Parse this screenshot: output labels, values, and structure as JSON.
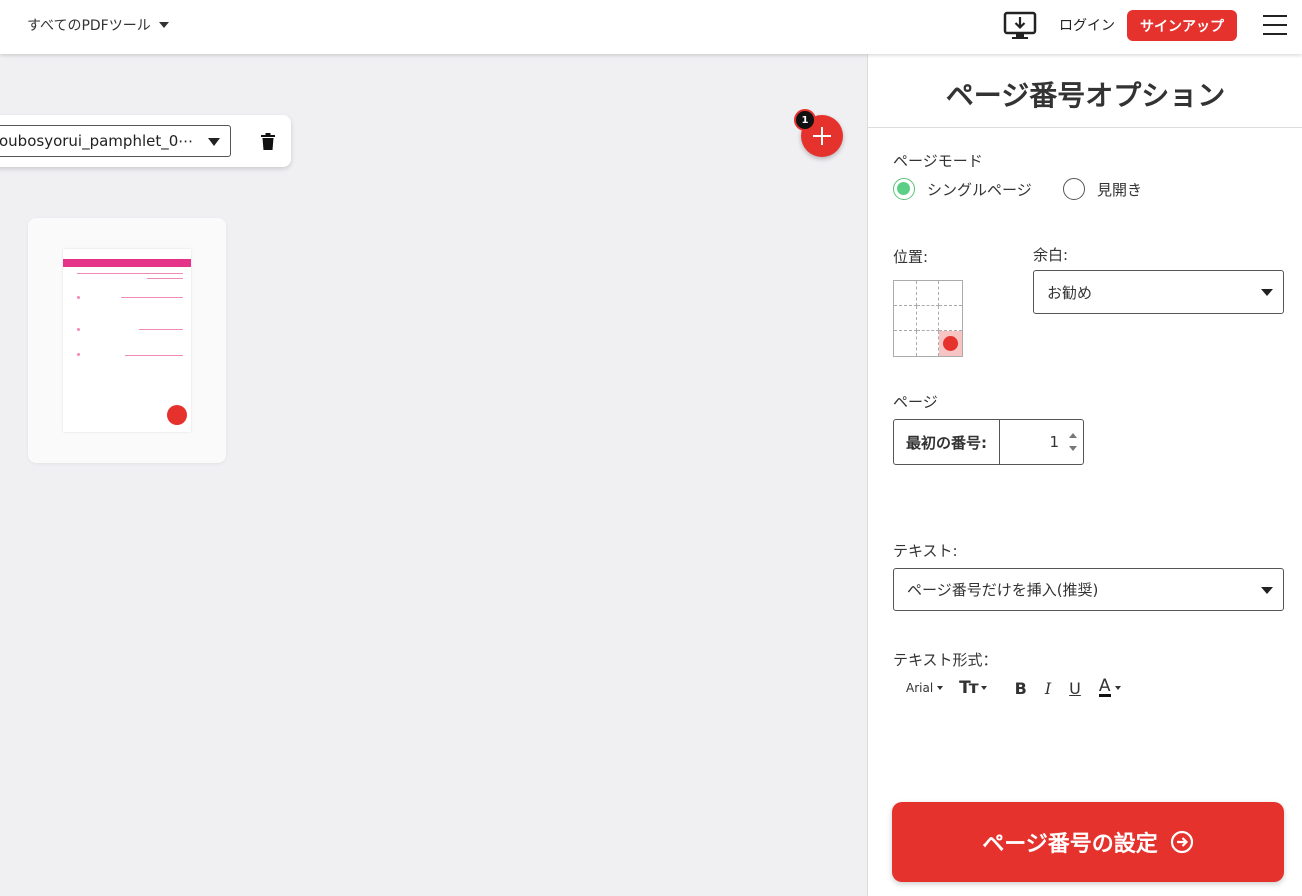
{
  "header": {
    "tools_menu_label": "すべてのPDFツール",
    "login_label": "ログイン",
    "signup_label": "サインアップ"
  },
  "workspace": {
    "file_name": "oubosyorui_pamphlet_0⋯",
    "file_count": "1"
  },
  "panel": {
    "title": "ページ番号オプション",
    "page_mode_label": "ページモード",
    "page_mode_options": [
      "シングルページ",
      "見開き"
    ],
    "page_mode_selected": "シングルページ",
    "position_label": "位置:",
    "position_selected": "bottom-right",
    "margin_label": "余白:",
    "margin_value": "お勧め",
    "pages_label": "ページ",
    "first_number_label": "最初の番号:",
    "first_number_value": "1",
    "text_label": "テキスト:",
    "text_value": "ページ番号だけを挿入(推奨)",
    "text_format_label": "テキスト形式：",
    "format": {
      "font": "Arial",
      "size_icon": "Tт",
      "bold": "B",
      "italic": "I",
      "underline": "U",
      "color": "A"
    },
    "submit_label": "ページ番号の設定"
  },
  "colors": {
    "accent": "#e5322d",
    "radio_on": "#5bcf85"
  },
  "icons": [
    "caret-down-icon",
    "desktop-download-icon",
    "hamburger-icon",
    "trash-icon",
    "plus-icon",
    "arrow-right-circle-icon"
  ]
}
